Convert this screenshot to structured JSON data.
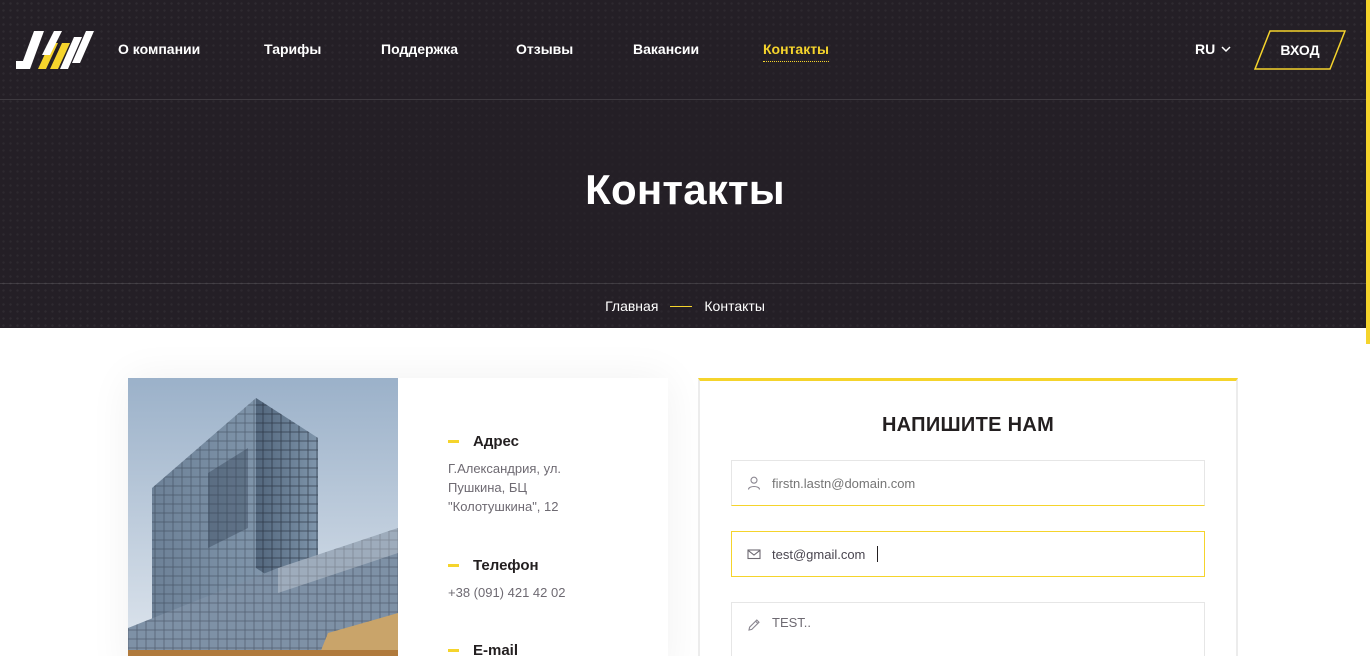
{
  "brand": {
    "logo_icon": "jw-logo-icon",
    "accent": "#f5d42c",
    "dark": "#241f26"
  },
  "nav": {
    "items": [
      {
        "label": "О компании"
      },
      {
        "label": "Тарифы"
      },
      {
        "label": "Поддержка"
      },
      {
        "label": "Отзывы"
      },
      {
        "label": "Вакансии"
      },
      {
        "label": "Контакты",
        "active": true
      }
    ],
    "language": "RU",
    "login_label": "ВХОД"
  },
  "page": {
    "title": "Контакты",
    "breadcrumb": {
      "home": "Главная",
      "current": "Контакты"
    }
  },
  "contacts": {
    "address": {
      "label": "Адрес",
      "value": "Г.Александрия, ул. Пушкина, БЦ \"Колотушкина\", 12"
    },
    "phone": {
      "label": "Телефон",
      "value": "+38 (091) 421 42 02"
    },
    "email": {
      "label": "E-mail"
    }
  },
  "form": {
    "title": "НАПИШИТЕ НАМ",
    "name_field": {
      "placeholder": "firstn.lastn@domain.com",
      "icon": "user-icon"
    },
    "email_field": {
      "value": "test@gmail.com",
      "icon": "envelope-icon"
    },
    "message_field": {
      "value": "TEST..",
      "icon": "pencil-icon"
    }
  }
}
